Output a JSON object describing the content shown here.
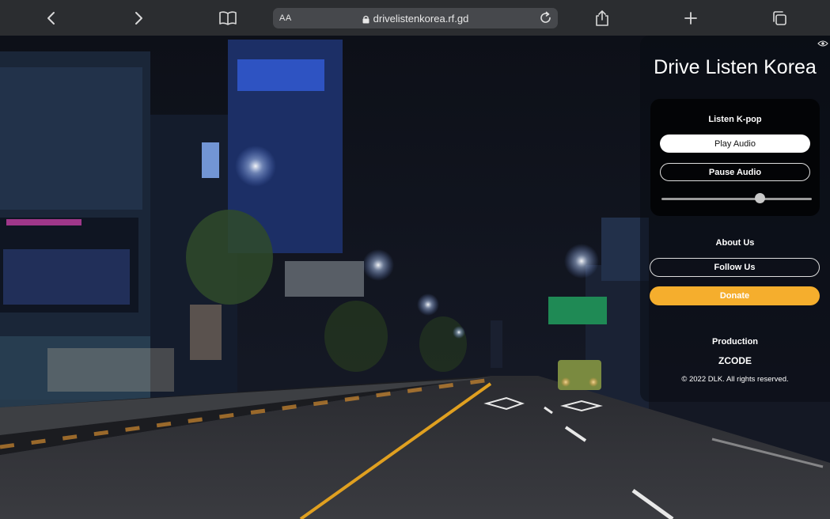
{
  "browser": {
    "text_size_label": "AA",
    "url": "drivelistenkorea.rf.gd"
  },
  "site": {
    "title": "Drive Listen Korea"
  },
  "audio_card": {
    "title": "Listen K-pop",
    "play_label": "Play Audio",
    "pause_label": "Pause Audio",
    "volume": 0.65
  },
  "links": {
    "about_label": "About Us",
    "follow_label": "Follow Us",
    "donate_label": "Donate"
  },
  "footer": {
    "production_label": "Production",
    "producer": "ZCODE",
    "copyright": "© 2022 DLK. All rights reserved."
  },
  "colors": {
    "toolbar_bg": "#2b2d30",
    "donate_accent": "#f5ae2d"
  }
}
